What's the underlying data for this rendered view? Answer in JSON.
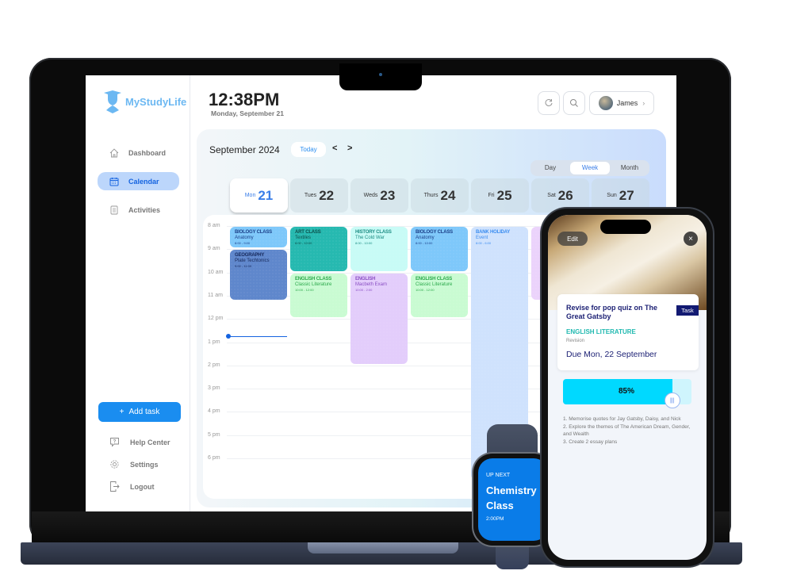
{
  "app": {
    "logo": "MyStudyLife",
    "clock": "12:38PM",
    "date": "Monday, September 21",
    "user": "James"
  },
  "sidebar": {
    "items": [
      {
        "label": "Dashboard",
        "icon": "home-icon"
      },
      {
        "label": "Calendar",
        "icon": "calendar-icon",
        "active": true
      },
      {
        "label": "Activities",
        "icon": "clipboard-icon"
      }
    ],
    "add_task": "Add task",
    "bottom": [
      {
        "label": "Help Center",
        "icon": "help-icon"
      },
      {
        "label": "Settings",
        "icon": "gear-icon"
      },
      {
        "label": "Logout",
        "icon": "logout-icon"
      }
    ]
  },
  "calendar": {
    "month": "September 2024",
    "today": "Today",
    "prev": "<",
    "next": ">",
    "views": [
      "Day",
      "Week",
      "Month"
    ],
    "active_view": "Week",
    "days": [
      {
        "name": "Mon",
        "num": "21",
        "active": true
      },
      {
        "name": "Tues",
        "num": "22"
      },
      {
        "name": "Weds",
        "num": "23"
      },
      {
        "name": "Thurs",
        "num": "24"
      },
      {
        "name": "Fri",
        "num": "25"
      },
      {
        "name": "Sat",
        "num": "26"
      },
      {
        "name": "Sun",
        "num": "27"
      }
    ],
    "hours": [
      "8 am",
      "9 am",
      "10 am",
      "11 am",
      "12 pm",
      "1 pm",
      "2 pm",
      "3 pm",
      "4 pm",
      "5 pm",
      "6 pm"
    ],
    "events": [
      {
        "day": 0,
        "start": 8.0,
        "end": 9.0,
        "title": "BIOLOGY CLASS",
        "sub": "Anatomy",
        "time": "8:00 - 9:00",
        "bg": "#7ec8fa",
        "fg": "#1b3f88"
      },
      {
        "day": 0,
        "start": 9.0,
        "end": 11.25,
        "title": "GEOGRAPHY",
        "sub": "Plate Techtonics",
        "time": "9:00 - 11:00",
        "bg": "#5f87cc",
        "fg": "#16285a"
      },
      {
        "day": 1,
        "start": 8.0,
        "end": 10.0,
        "title": "ART CLASS",
        "sub": "Textiles",
        "time": "8:00 - 10:00",
        "bg": "#26b9b0",
        "fg": "#0d4f4b"
      },
      {
        "day": 1,
        "start": 10.0,
        "end": 12.0,
        "title": "ENGLISH CLASS",
        "sub": "Classic Literature",
        "time": "10:00 - 12:00",
        "bg": "#c9fbd2",
        "fg": "#2aa84a"
      },
      {
        "day": 2,
        "start": 8.0,
        "end": 10.0,
        "title": "HISTORY CLASS",
        "sub": "The Cold War",
        "time": "8:00 - 10:00",
        "bg": "#c8fbf6",
        "fg": "#1b8c83"
      },
      {
        "day": 2,
        "start": 10.0,
        "end": 14.0,
        "title": "ENGLISH",
        "sub": "Macbeth Exam",
        "time": "10:00 - 2:00",
        "bg": "#e3cdfb",
        "fg": "#8a4fc4"
      },
      {
        "day": 3,
        "start": 8.0,
        "end": 10.0,
        "title": "BIOLOGY CLASS",
        "sub": "Anatomy",
        "time": "8:00 - 10:00",
        "bg": "#7ec8fa",
        "fg": "#1b3f88"
      },
      {
        "day": 3,
        "start": 10.0,
        "end": 12.0,
        "title": "ENGLISH CLASS",
        "sub": "Classic Literature",
        "time": "10:00 - 12:00",
        "bg": "#c9fbd2",
        "fg": "#2aa84a"
      },
      {
        "day": 4,
        "start": 8.0,
        "end": 19.0,
        "title": "BANK HOLIDAY",
        "sub": "Event",
        "time": "8:00 - 6:00",
        "bg": "#cfe2fd",
        "fg": "#3a8cf0"
      },
      {
        "day": 5,
        "start": 8.0,
        "end": 11.25,
        "title": "",
        "sub": "",
        "time": "",
        "bg": "#ebd3fb",
        "fg": "#8a4fc4"
      }
    ],
    "now_hour": 12.75
  },
  "phone": {
    "edit": "Edit",
    "close": "×",
    "task_title": "Revise for pop quiz on The Great Gatsby",
    "badge": "Task",
    "subject": "ENGLISH LITERATURE",
    "type": "Revision",
    "due": "Due Mon, 22 September",
    "progress_pct": 85,
    "progress_label": "85%",
    "notes": [
      "1. Memorise quotes for Jay Gatsby, Daisy, and Nick",
      "2. Explore the themes of The American Dream, Gender, and Wealth",
      "3. Create 2 essay plans"
    ]
  },
  "watch": {
    "label": "UP NEXT",
    "title": "Chemistry Class",
    "time": "2:00PM"
  }
}
